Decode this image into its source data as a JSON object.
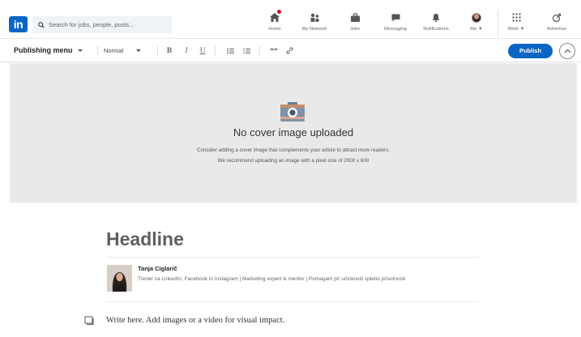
{
  "nav": {
    "logo_text": "in",
    "search": {
      "placeholder": "Search for jobs, people, posts..."
    },
    "items": [
      {
        "label": "Home",
        "icon": "home-icon",
        "has_badge": true
      },
      {
        "label": "My Network",
        "icon": "network-icon"
      },
      {
        "label": "Jobs",
        "icon": "briefcase-icon"
      },
      {
        "label": "Messaging",
        "icon": "chat-icon"
      },
      {
        "label": "Notifications",
        "icon": "bell-icon"
      },
      {
        "label": "Me ▼",
        "icon": "avatar"
      },
      {
        "label": "Work ▼",
        "icon": "grid-icon"
      },
      {
        "label": "Advertise",
        "icon": "advertise-icon"
      }
    ]
  },
  "toolbar": {
    "publishing_menu": "Publishing menu",
    "text_style": "Normal",
    "bold": "B",
    "italic": "I",
    "underline": "U",
    "quote": "❝❝",
    "publish_label": "Publish"
  },
  "cover": {
    "title": "No cover image uploaded",
    "line1": "Consider adding a cover image that complements your article to attract more readers.",
    "line2": "We recommend uploading an image with a pixel size of 2000 x 600"
  },
  "article": {
    "headline_placeholder": "Headline",
    "author_name": "Tanja Ciglarič",
    "author_bio": "Trener za LinkedIn, Facebook in Instagram | Marketing expert & mentor | Pomagam pri učinkoviti spletni prisotnosti",
    "body_placeholder": "Write here. Add images or a video for visual impact."
  },
  "colors": {
    "brand_blue": "#0a66c2",
    "notification_red": "#cc1016",
    "cover_bg": "#e9e9e9"
  }
}
